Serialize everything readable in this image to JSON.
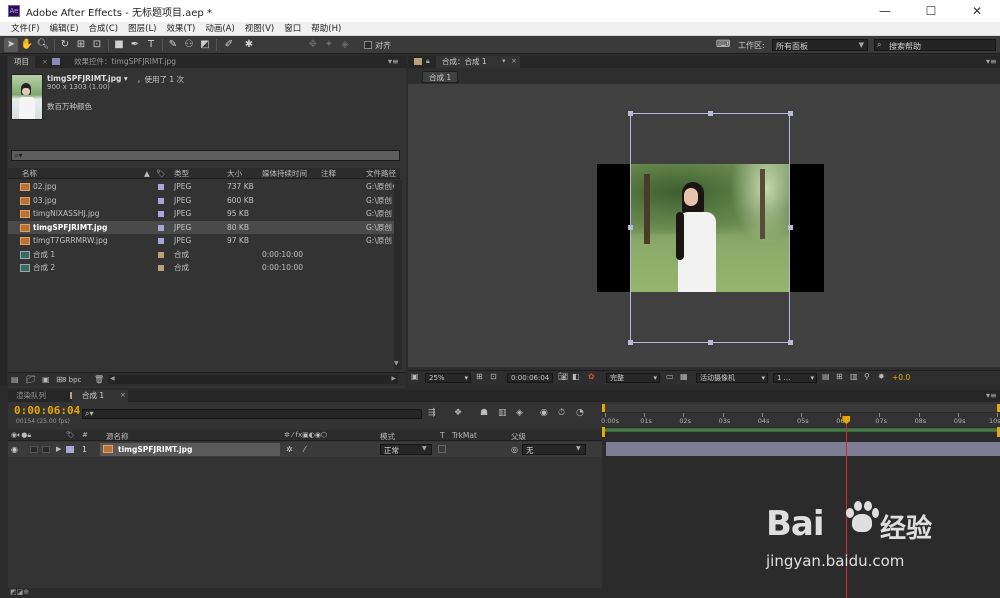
{
  "window": {
    "title": "Adobe After Effects - 无标题项目.aep *",
    "logo_text": "Ae",
    "min": "—",
    "max": "☐",
    "close": "✕"
  },
  "menu": [
    "文件(F)",
    "编辑(E)",
    "合成(C)",
    "图层(L)",
    "效果(T)",
    "动画(A)",
    "视图(V)",
    "窗口",
    "帮助(H)"
  ],
  "toolbar": {
    "align_label": "对齐",
    "workspace_label": "工作区:",
    "workspace_value": "所有面板",
    "search_placeholder": "搜索帮助"
  },
  "project": {
    "tab_project": "项目",
    "tab_effects": "效果控件：timgSPFJRIMT.jpg",
    "preview_name": "timgSPFJRIMT.jpg ▾",
    "preview_used": "，使用了 1 次",
    "preview_dims": "900 x 1303 (1.00)",
    "preview_color": "数百万种颜色",
    "search_placeholder": "",
    "columns": {
      "name": "名称",
      "type": "类型",
      "size": "大小",
      "duration": "媒体持续时间",
      "comment": "注释",
      "path": "文件路径"
    },
    "items": [
      {
        "name": "02.jpg",
        "type": "JPEG",
        "size": "737 KB",
        "duration": "",
        "path": "G:\\原创",
        "kind": "image",
        "label": "#a8a8d8"
      },
      {
        "name": "03.jpg",
        "type": "JPEG",
        "size": "600 KB",
        "duration": "",
        "path": "G:\\原创",
        "kind": "image",
        "label": "#a8a8d8"
      },
      {
        "name": "timgNIXASSHJ.jpg",
        "type": "JPEG",
        "size": "95 KB",
        "duration": "",
        "path": "G:\\原创",
        "kind": "image",
        "label": "#a8a8d8"
      },
      {
        "name": "timgSPFJRIMT.jpg",
        "type": "JPEG",
        "size": "80 KB",
        "duration": "",
        "path": "G:\\原创",
        "kind": "image",
        "label": "#a8a8d8",
        "selected": true
      },
      {
        "name": "timgT7GRRMRW.jpg",
        "type": "JPEG",
        "size": "97 KB",
        "duration": "",
        "path": "G:\\原创",
        "kind": "image",
        "label": "#a8a8d8"
      },
      {
        "name": "合成 1",
        "type": "合成",
        "size": "",
        "duration": "0:00:10:00",
        "path": "",
        "kind": "comp",
        "label": "#b8a07a"
      },
      {
        "name": "合成 2",
        "type": "合成",
        "size": "",
        "duration": "0:00:10:00",
        "path": "",
        "kind": "comp",
        "label": "#b8a07a"
      }
    ],
    "bpc": "8 bpc"
  },
  "comp": {
    "tab": "合成：合成 1",
    "breadcrumb": "合成 1",
    "zoom": "25%",
    "timecode": "0:00:06:04",
    "resolution": "完整",
    "camera": "活动摄像机",
    "views": "1 ...",
    "exposure": "+0.0"
  },
  "timeline": {
    "tab_render": "渲染队列",
    "tab_comp": "合成 1",
    "timecode": "0:00:06:04",
    "fps": "00154 (25.00 fps)",
    "search_placeholder": "",
    "columns": {
      "hash": "#",
      "source": "源名称",
      "mode": "模式",
      "t": "T",
      "trkmat": "TrkMat",
      "parent": "父级"
    },
    "layers": [
      {
        "index": "1",
        "name": "timgSPFJRIMT.jpg",
        "mode": "正常",
        "parent": "无"
      }
    ],
    "ruler": [
      "0:00s",
      "01s",
      "02s",
      "03s",
      "04s",
      "05s",
      "06s",
      "07s",
      "08s",
      "09s",
      "10s"
    ],
    "playhead_fraction": 0.616
  },
  "watermark": {
    "brand": "Bai",
    "brand_cn": "经验",
    "url": "jingyan.baidu.com"
  },
  "colors": {
    "accent_orange": "#e6a700",
    "playhead": "#d42a2a",
    "workarea": "#2d8a2d",
    "layerbar": "#9a9ab8"
  }
}
